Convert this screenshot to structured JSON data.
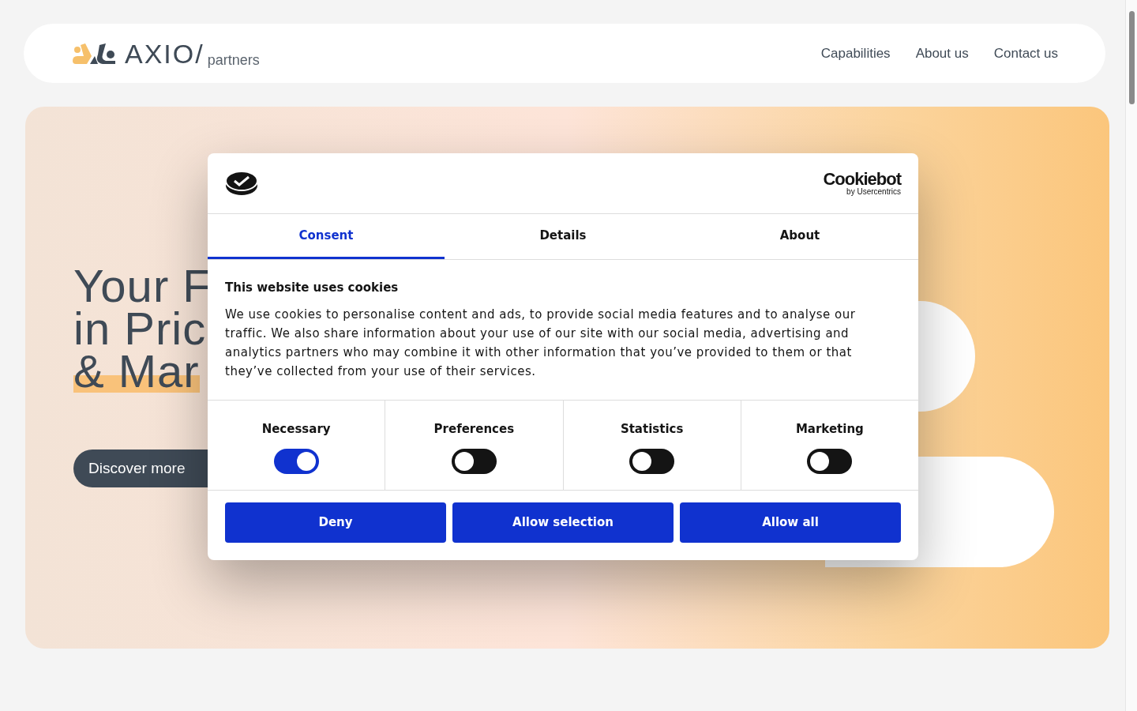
{
  "header": {
    "logo": {
      "word": "AXIO/",
      "sub": "partners"
    },
    "nav": [
      "Capabilities",
      "About us",
      "Contact us"
    ]
  },
  "hero": {
    "headline_lines": [
      {
        "text": "Your F",
        "highlighted": false
      },
      {
        "text": "in Pric",
        "highlighted": false
      },
      {
        "text": "& Mar",
        "highlighted": true
      }
    ],
    "cta": "Discover more"
  },
  "cookie_dialog": {
    "brand": {
      "name": "Cookiebot",
      "by": "by Usercentrics"
    },
    "tabs": [
      {
        "label": "Consent",
        "selected": true
      },
      {
        "label": "Details",
        "selected": false
      },
      {
        "label": "About",
        "selected": false
      }
    ],
    "title": "This website uses cookies",
    "body": "We use cookies to personalise content and ads, to provide social media features and to analyse our traffic. We also share information about your use of our site with our social media, advertising and analytics partners who may combine it with other information that you’ve provided to them or that they’ve collected from your use of their services.",
    "categories": [
      {
        "label": "Necessary",
        "on": true
      },
      {
        "label": "Preferences",
        "on": false
      },
      {
        "label": "Statistics",
        "on": false
      },
      {
        "label": "Marketing",
        "on": false
      }
    ],
    "buttons": [
      "Deny",
      "Allow selection",
      "Allow all"
    ]
  }
}
